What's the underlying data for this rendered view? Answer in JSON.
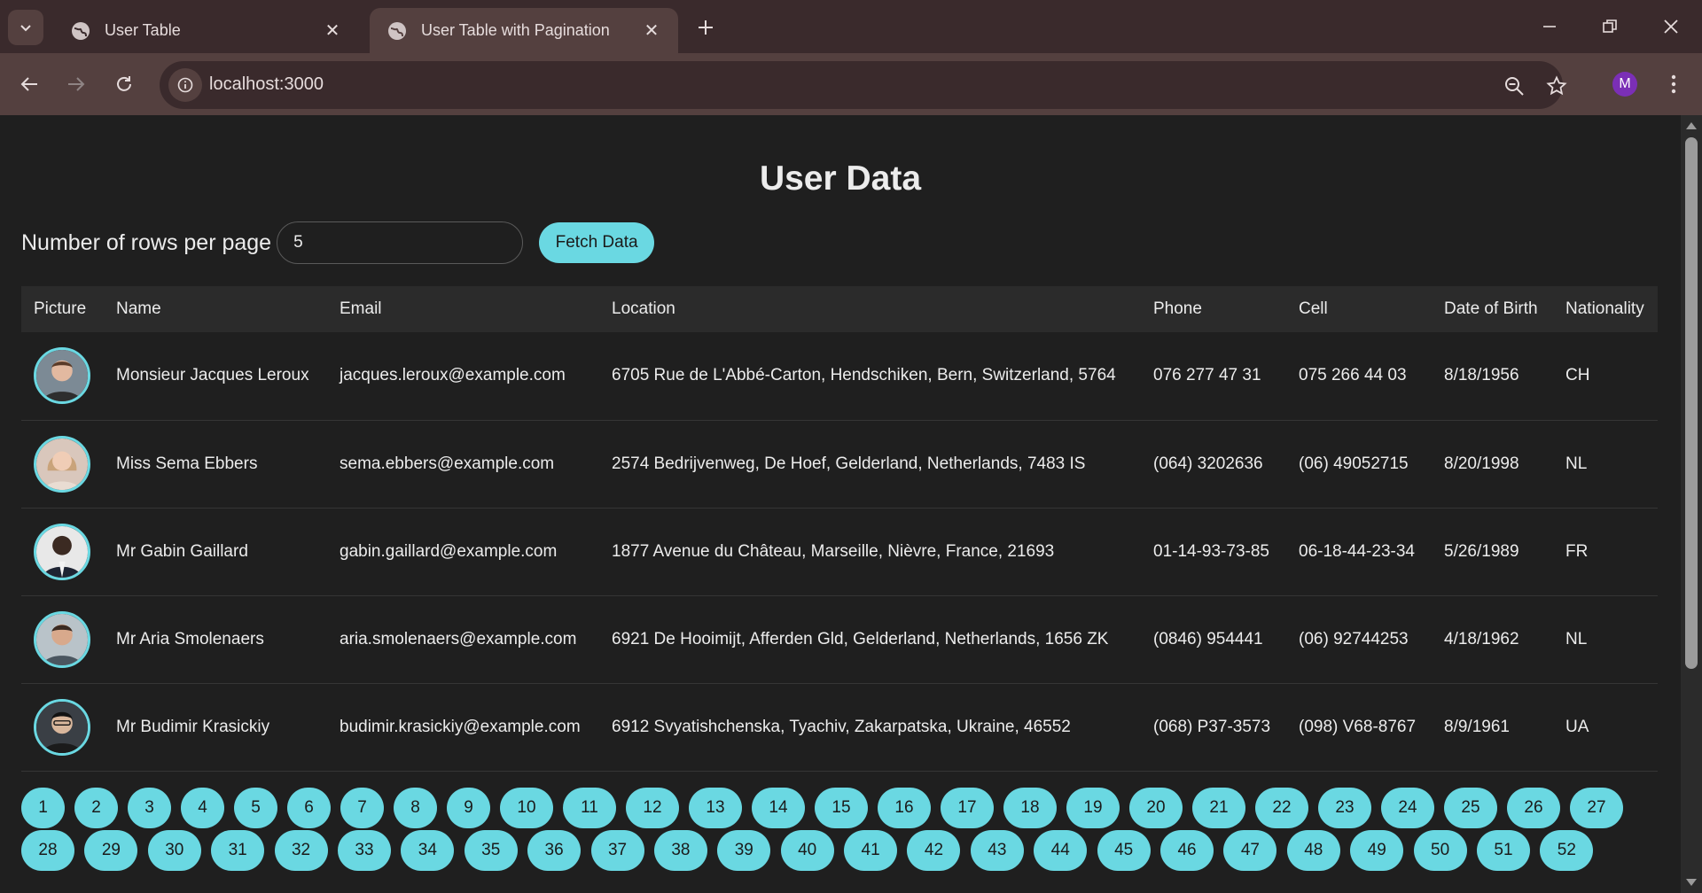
{
  "browser": {
    "tabs": [
      {
        "title": "User Table",
        "active": false
      },
      {
        "title": "User Table with Pagination",
        "active": true
      }
    ],
    "url": "localhost:3000",
    "profile_initial": "M"
  },
  "page": {
    "title": "User Data",
    "rows_label": "Number of rows per page",
    "rows_value": "5",
    "fetch_label": "Fetch Data",
    "accent_color": "#6ad8e2"
  },
  "table": {
    "headers": [
      "Picture",
      "Name",
      "Email",
      "Location",
      "Phone",
      "Cell",
      "Date of Birth",
      "Nationality"
    ],
    "rows": [
      {
        "name": "Monsieur Jacques Leroux",
        "email": "jacques.leroux@example.com",
        "location": "6705 Rue de L'Abbé-Carton, Hendschiken, Bern, Switzerland, 5764",
        "phone": "076 277 47 31",
        "cell": "075 266 44 03",
        "dob": "8/18/1956",
        "nat": "CH"
      },
      {
        "name": "Miss Sema Ebbers",
        "email": "sema.ebbers@example.com",
        "location": "2574 Bedrijvenweg, De Hoef, Gelderland, Netherlands, 7483 IS",
        "phone": "(064) 3202636",
        "cell": "(06) 49052715",
        "dob": "8/20/1998",
        "nat": "NL"
      },
      {
        "name": "Mr Gabin Gaillard",
        "email": "gabin.gaillard@example.com",
        "location": "1877 Avenue du Château, Marseille, Nièvre, France, 21693",
        "phone": "01-14-93-73-85",
        "cell": "06-18-44-23-34",
        "dob": "5/26/1989",
        "nat": "FR"
      },
      {
        "name": "Mr Aria Smolenaers",
        "email": "aria.smolenaers@example.com",
        "location": "6921 De Hooimijt, Afferden Gld, Gelderland, Netherlands, 1656 ZK",
        "phone": "(0846) 954441",
        "cell": "(06) 92744253",
        "dob": "4/18/1962",
        "nat": "NL"
      },
      {
        "name": "Mr Budimir Krasickiy",
        "email": "budimir.krasickiy@example.com",
        "location": "6912 Svyatishchenska, Tyachiv, Zakarpatska, Ukraine, 46552",
        "phone": "(068) P37-3573",
        "cell": "(098) V68-8767",
        "dob": "8/9/1961",
        "nat": "UA"
      }
    ]
  },
  "pagination": {
    "row1": [
      "1",
      "2",
      "3",
      "4",
      "5",
      "6",
      "7",
      "8",
      "9",
      "10",
      "11",
      "12",
      "13",
      "14",
      "15",
      "16",
      "17",
      "18",
      "19",
      "20",
      "21",
      "22",
      "23",
      "24",
      "25",
      "26",
      "27"
    ],
    "row2": [
      "28",
      "29",
      "30",
      "31",
      "32",
      "33",
      "34",
      "35",
      "36",
      "37",
      "38",
      "39",
      "40",
      "41",
      "42",
      "43",
      "44",
      "45",
      "46",
      "47",
      "48",
      "49",
      "50",
      "51",
      "52"
    ]
  }
}
